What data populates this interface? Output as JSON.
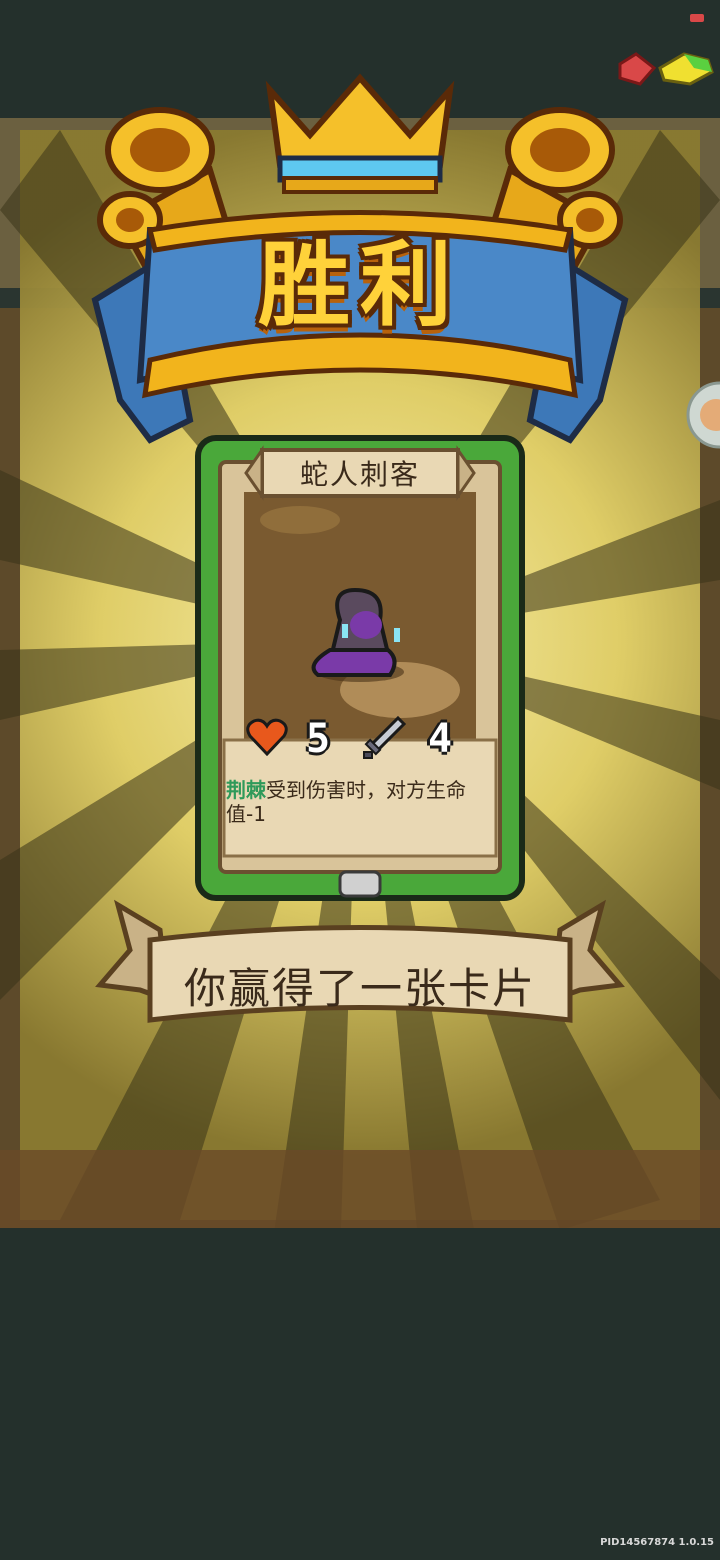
{
  "victory": {
    "title": "胜利"
  },
  "card": {
    "name": "蛇人刺客",
    "health": "5",
    "attack": "4",
    "keyword": "荆棘",
    "description": "受到伤害时，对方生命值-1"
  },
  "reward": {
    "message": "你赢得了一张卡片"
  },
  "footer": {
    "build_id": "PID14567874 1.0.15"
  },
  "icons": {
    "top_right_a": "red-gem-icon",
    "top_right_b": "yellow-green-gem-icon",
    "side_button": "side-menu-icon",
    "heart": "heart-icon",
    "sword": "sword-icon"
  },
  "colors": {
    "background": "#24302c",
    "ray_yellow": "#f3e27a",
    "banner_gold": "#ffd23a",
    "ribbon_blue": "#4a88c8",
    "card_green": "#4aa83a",
    "parchment": "#e9d8b4"
  }
}
